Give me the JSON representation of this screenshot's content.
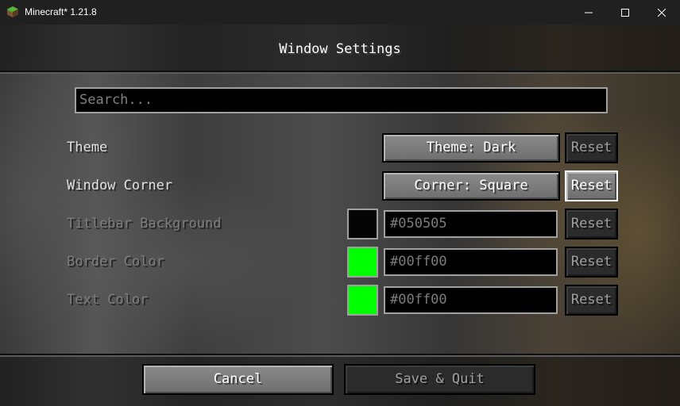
{
  "window": {
    "title": "Minecraft* 1.21.8",
    "icon": "grass-block-icon",
    "controls": [
      "minimize-icon",
      "maximize-icon",
      "close-icon"
    ]
  },
  "screen": {
    "title": "Window Settings"
  },
  "search": {
    "placeholder": "Search..."
  },
  "settings": [
    {
      "label": "Theme",
      "value": "Theme: Dark",
      "reset": "Reset",
      "enabled": true
    },
    {
      "label": "Window Corner",
      "value": "Corner: Square",
      "reset": "Reset",
      "enabled": true
    },
    {
      "label": "Titlebar Background",
      "value": "#050505",
      "swatch": "#050505",
      "reset": "Reset",
      "enabled": false
    },
    {
      "label": "Border Color",
      "value": "#00ff00",
      "swatch": "#00ff00",
      "reset": "Reset",
      "enabled": false
    },
    {
      "label": "Text Color",
      "value": "#00ff00",
      "swatch": "#00ff00",
      "reset": "Reset",
      "enabled": false
    }
  ],
  "footer": {
    "cancel": "Cancel",
    "save": "Save & Quit"
  }
}
